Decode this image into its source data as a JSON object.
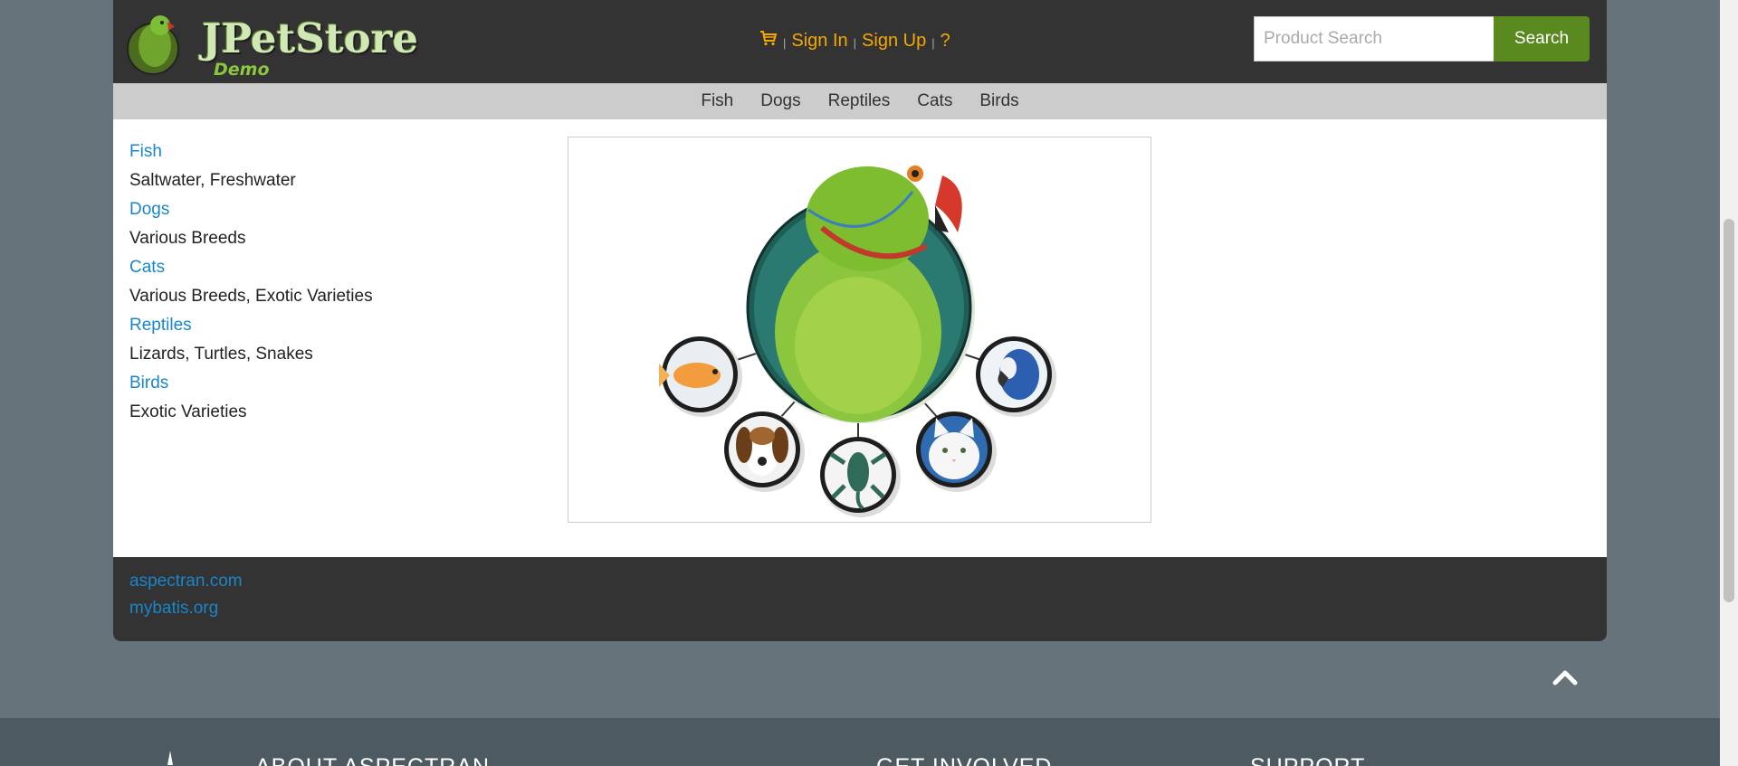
{
  "header": {
    "logo_text": "JPetStore",
    "logo_sub": "Demo",
    "menu": {
      "sign_in": "Sign In",
      "sign_up": "Sign Up",
      "help": "?",
      "separator": "|"
    },
    "search": {
      "placeholder": "Product Search",
      "button_label": "Search"
    }
  },
  "quicknav": [
    "Fish",
    "Dogs",
    "Reptiles",
    "Cats",
    "Birds"
  ],
  "sidebar": [
    {
      "label": "Fish",
      "desc": "Saltwater, Freshwater"
    },
    {
      "label": "Dogs",
      "desc": "Various Breeds"
    },
    {
      "label": "Cats",
      "desc": "Various Breeds, Exotic Varieties"
    },
    {
      "label": "Reptiles",
      "desc": "Lizards, Turtles, Snakes"
    },
    {
      "label": "Birds",
      "desc": "Exotic Varieties"
    }
  ],
  "footer_links": [
    "aspectran.com",
    "mybatis.org"
  ],
  "site_footer": {
    "about": "ABOUT ASPECTRAN",
    "involved": "GET INVOLVED",
    "support": "SUPPORT"
  },
  "icons": {
    "cart": "cart-icon",
    "to_top": "chevron-up-icon"
  },
  "colors": {
    "header_bg": "#333333",
    "accent_orange": "#f5a800",
    "link_blue": "#1a86c8",
    "search_green": "#5a8a1f",
    "page_bg": "#66737b"
  }
}
